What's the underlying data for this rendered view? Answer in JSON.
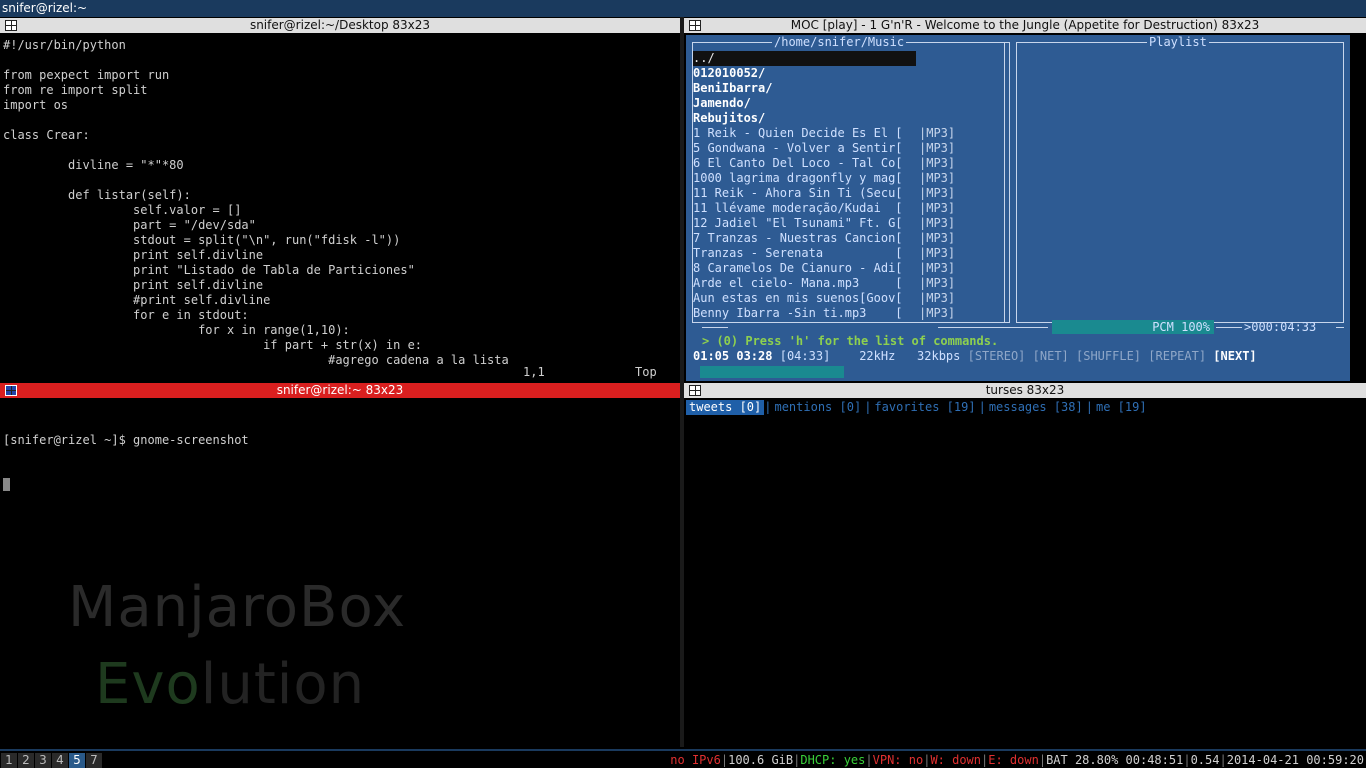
{
  "topbar": {
    "title": "snifer@rizel:~"
  },
  "editor": {
    "title": "snifer@rizel:~/Desktop 83x23",
    "lines": [
      "#!/usr/bin/python",
      "",
      "from pexpect import run",
      "from re import split",
      "import os",
      "",
      "class Crear:",
      "",
      "         divline = \"*\"*80",
      "",
      "         def listar(self):",
      "                  self.valor = []",
      "                  part = \"/dev/sda\"",
      "                  stdout = split(\"\\n\", run(\"fdisk -l\"))",
      "                  print self.divline",
      "                  print \"Listado de Tabla de Particiones\"",
      "                  print self.divline",
      "                  #print self.divline",
      "                  for e in stdout:",
      "                           for x in range(1,10):",
      "                                    if part + str(x) in e:",
      "                                             #agrego cadena a la lista"
    ],
    "status_pos": "1,1",
    "status_scroll": "Top"
  },
  "shell": {
    "title": "snifer@rizel:~ 83x23",
    "prompt": "[snifer@rizel ~]$ gnome-screenshot"
  },
  "moc": {
    "title": "MOC [play] - 1 G'n'R - Welcome to the Jungle (Appetite for Destruction) 83x23",
    "dir_title": "/home/snifer/Music",
    "playlist_title": "Playlist",
    "items": [
      {
        "name": "../",
        "fmt": "",
        "kind": "sel"
      },
      {
        "name": "012010052/",
        "fmt": "",
        "kind": "dir"
      },
      {
        "name": "BeniIbarra/",
        "fmt": "",
        "kind": "dir"
      },
      {
        "name": "Jamendo/",
        "fmt": "",
        "kind": "dir"
      },
      {
        "name": "Rebujitos/",
        "fmt": "",
        "kind": "dir"
      },
      {
        "name": "1 Reik - Quien Decide Es El [",
        "fmt": "|MP3]",
        "kind": "file"
      },
      {
        "name": "5 Gondwana - Volver a Sentir[",
        "fmt": "|MP3]",
        "kind": "file"
      },
      {
        "name": "6 El Canto Del Loco - Tal Co[",
        "fmt": "|MP3]",
        "kind": "file"
      },
      {
        "name": "1000 lagrima dragonfly y mag[",
        "fmt": "|MP3]",
        "kind": "file"
      },
      {
        "name": "11 Reik - Ahora Sin Ti (Secu[",
        "fmt": "|MP3]",
        "kind": "file"
      },
      {
        "name": "11 llévame moderação/Kudai  [",
        "fmt": "|MP3]",
        "kind": "file"
      },
      {
        "name": "12 Jadiel \"El Tsunami\" Ft. G[",
        "fmt": "|MP3]",
        "kind": "file"
      },
      {
        "name": "7 Tranzas - Nuestras Cancion[",
        "fmt": "|MP3]",
        "kind": "file"
      },
      {
        "name": "Tranzas - Serenata          [",
        "fmt": "|MP3]",
        "kind": "file"
      },
      {
        "name": "8 Caramelos De Cianuro - Adi[",
        "fmt": "|MP3]",
        "kind": "file"
      },
      {
        "name": "Arde el cielo- Mana.mp3     [",
        "fmt": "|MP3]",
        "kind": "file"
      },
      {
        "name": "Aun estas en mis suenos[Goov[",
        "fmt": "|MP3]",
        "kind": "file"
      },
      {
        "name": "Benny Ibarra -Sin ti.mp3    [",
        "fmt": "|MP3]",
        "kind": "file"
      }
    ],
    "pcm": "PCM 100%",
    "remaining": ">000:04:33",
    "message": "> (0) Press 'h' for the list of commands.",
    "elapsed": "01:05",
    "left": "03:28",
    "total": "[04:33]",
    "rate": "22kHz",
    "bitrate": "32kbps",
    "flags": [
      "[STEREO]",
      "[NET]",
      "[SHUFFLE]",
      "[REPEAT]",
      "[NEXT]"
    ],
    "progress_fraction": 0.24
  },
  "turses": {
    "title": "turses 83x23",
    "tabs": [
      {
        "label": "tweets [0]",
        "active": true
      },
      {
        "label": "mentions [0]",
        "active": false
      },
      {
        "label": "favorites [19]",
        "active": false
      },
      {
        "label": "messages [38]",
        "active": false
      },
      {
        "label": "me [19]",
        "active": false
      }
    ]
  },
  "watermark": {
    "line1": "ManjaroBox",
    "line2_a": "Evo",
    "line2_b": "lution"
  },
  "workspaces": [
    "1",
    "2",
    "3",
    "4",
    "5",
    "7"
  ],
  "active_workspace": "5",
  "status": {
    "ipv6": "no IPv6",
    "disk": "100.6 GiB",
    "dhcp": "DHCP: yes",
    "vpn": "VPN: no",
    "wifi": "W: down",
    "eth": "E: down",
    "battery": "BAT 28.80% 00:48:51",
    "load": "0.54",
    "datetime": "2014-04-21 00:59:20"
  }
}
